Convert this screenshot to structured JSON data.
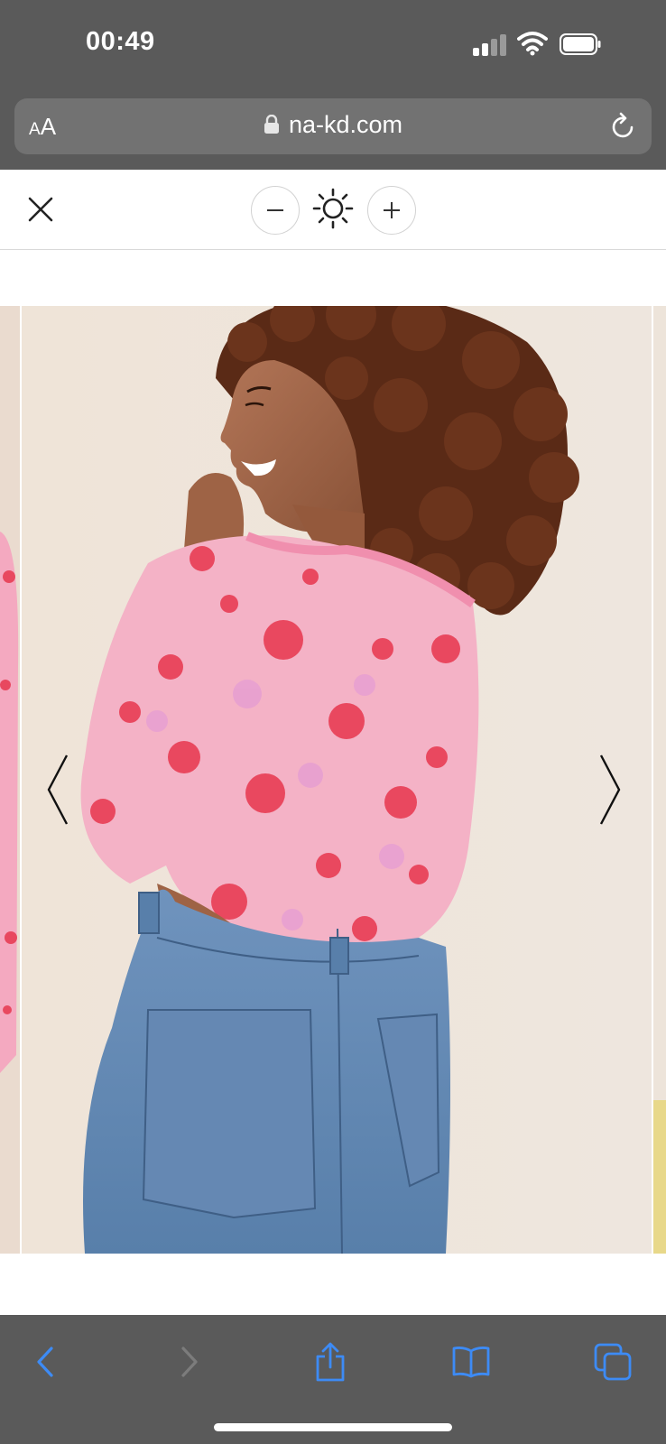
{
  "status_bar": {
    "time": "00:49",
    "icons": [
      "cellular-signal-icon",
      "wifi-icon",
      "battery-icon"
    ]
  },
  "browser": {
    "text_size_label_small": "A",
    "text_size_label_large": "A",
    "url": "na-kd.com",
    "icons": [
      "lock-icon",
      "reload-icon"
    ]
  },
  "viewer_toolbar": {
    "icons": [
      "close-icon",
      "zoom-out-icon",
      "brightness-icon",
      "zoom-in-icon"
    ]
  },
  "product_image": {
    "description_icon": "product-photo",
    "navigation": [
      "previous-arrow-icon",
      "next-arrow-icon"
    ]
  },
  "bottom_toolbar": {
    "icons": [
      "back-icon",
      "forward-icon",
      "share-icon",
      "bookmarks-icon",
      "tabs-icon"
    ],
    "accent_color": "#3d8bf5",
    "disabled_color": "#7c7c7c"
  }
}
